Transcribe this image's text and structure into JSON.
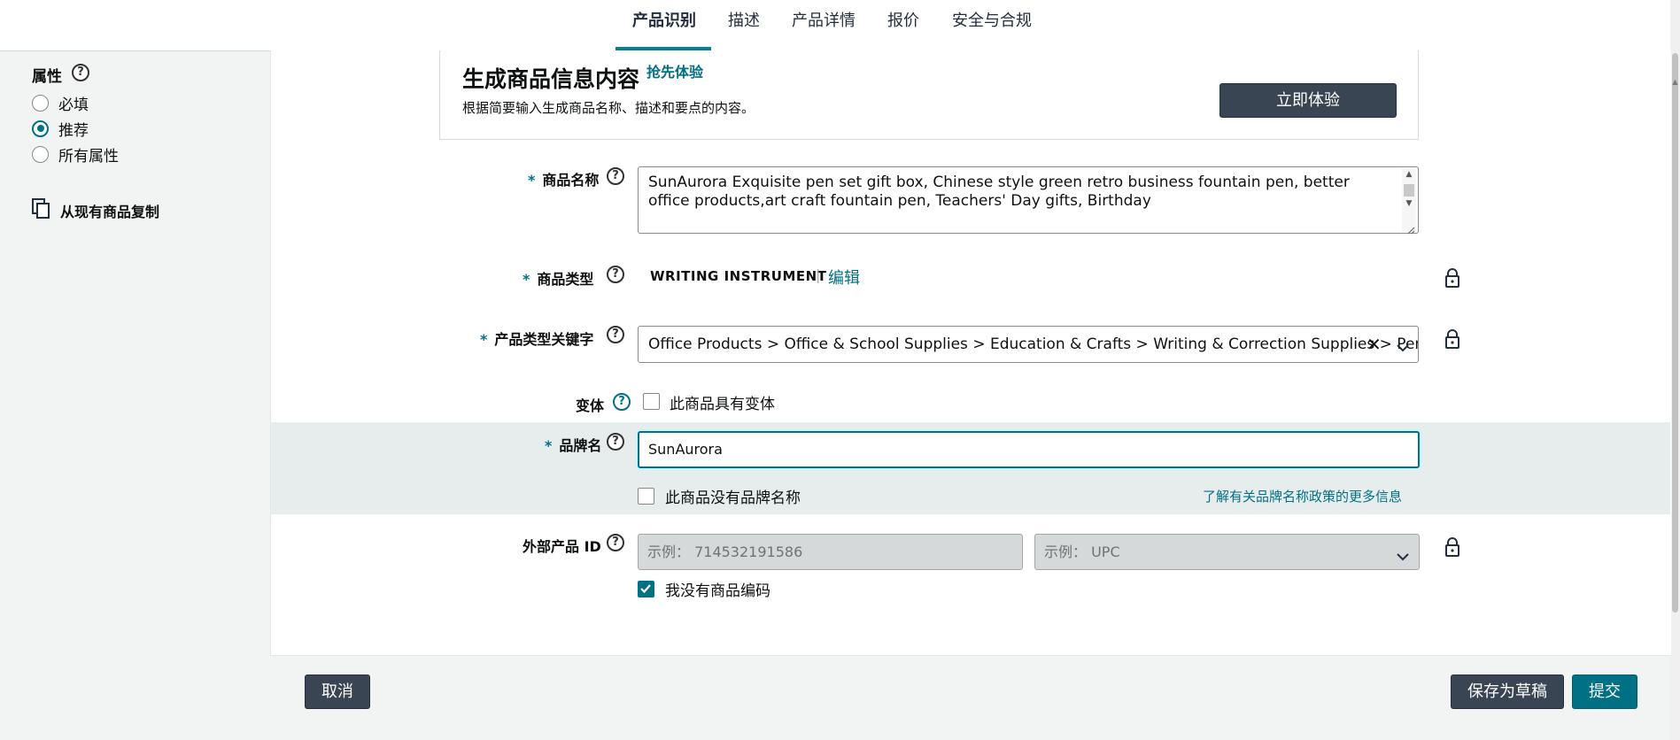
{
  "tabs": [
    {
      "label": "产品识别",
      "active": true
    },
    {
      "label": "描述",
      "active": false
    },
    {
      "label": "产品详情",
      "active": false
    },
    {
      "label": "报价",
      "active": false
    },
    {
      "label": "安全与合规",
      "active": false
    }
  ],
  "sidebar": {
    "title": "属性",
    "help": "?",
    "filters": [
      {
        "label": "必填",
        "selected": false
      },
      {
        "label": "推荐",
        "selected": true
      },
      {
        "label": "所有属性",
        "selected": false
      }
    ],
    "copy_label": "从现有商品复制"
  },
  "promo": {
    "title": "生成商品信息内容",
    "badge": "抢先体验",
    "description": "根据简要输入生成商品名称、描述和要点的内容。",
    "button": "立即体验"
  },
  "form": {
    "required_mark": "*",
    "help": "?",
    "product_name": {
      "label": "商品名称",
      "value": "SunAurora Exquisite pen set gift box, Chinese style green retro business fountain pen, better office products,art craft fountain pen, Teachers' Day gifts, Birthday"
    },
    "product_type": {
      "label": "商品类型",
      "value": "WRITING INSTRUMENT",
      "separator": "|",
      "edit": "编辑"
    },
    "type_keyword": {
      "label": "产品类型关键字",
      "value": "Office Products > Office & School Supplies > Education & Crafts > Writing & Correction Supplies > Pen"
    },
    "variation": {
      "label": "变体",
      "checkbox_label": "此商品具有变体",
      "checked": false
    },
    "brand": {
      "label": "品牌名",
      "value": "SunAurora",
      "no_brand_label": "此商品没有品牌名称",
      "no_brand_checked": false,
      "policy_link": "了解有关品牌名称政策的更多信息"
    },
    "external_id": {
      "label": "外部产品 ID",
      "id_placeholder": "示例：  714532191586",
      "type_placeholder": "示例：  UPC",
      "no_code_label": "我没有商品编码",
      "no_code_checked": true
    }
  },
  "footer": {
    "cancel": "取消",
    "save_draft": "保存为草稿",
    "submit": "提交"
  },
  "colors": {
    "accent": "#007185",
    "dark_button": "#3a4553"
  }
}
